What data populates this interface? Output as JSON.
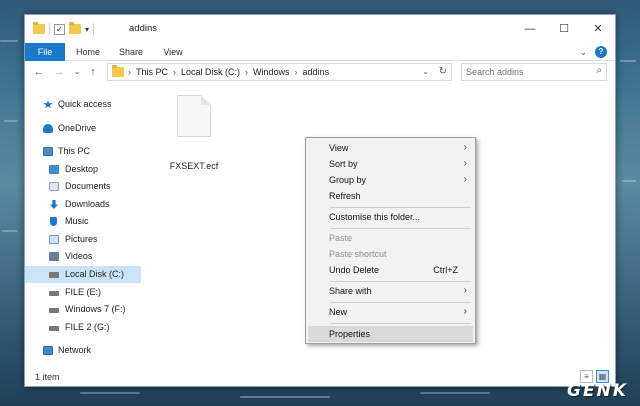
{
  "window": {
    "title": "addins",
    "controls": {
      "minimize": "—",
      "maximize": "☐",
      "close": "✕"
    }
  },
  "ribbon": {
    "tabs": [
      "File",
      "Home",
      "Share",
      "View"
    ],
    "expand_glyph": "⌄",
    "help_glyph": "?"
  },
  "nav": {
    "back": "←",
    "forward": "→",
    "recent": "⌄",
    "up": "↑",
    "breadcrumb": [
      "This PC",
      "Local Disk (C:)",
      "Windows",
      "addins"
    ],
    "crumb_sep": "›",
    "search_placeholder": "Search addins",
    "search_glyph": "⌕",
    "refresh_glyph": "↻",
    "dropdown_glyph": "⌄"
  },
  "navpane": {
    "items": [
      {
        "label": "Quick access",
        "icon": "star-icon",
        "color": "#1979ca"
      },
      {
        "label": "OneDrive",
        "icon": "cloud-icon",
        "color": "#1979ca"
      },
      {
        "label": "This PC",
        "icon": "computer-icon",
        "color": "#4a90c8"
      },
      {
        "label": "Desktop",
        "icon": "desktop-icon",
        "color": "#3a8ad0"
      },
      {
        "label": "Documents",
        "icon": "documents-icon",
        "color": "#8aa0b8"
      },
      {
        "label": "Downloads",
        "icon": "downloads-icon",
        "color": "#1979ca"
      },
      {
        "label": "Music",
        "icon": "music-icon",
        "color": "#1979ca"
      },
      {
        "label": "Pictures",
        "icon": "pictures-icon",
        "color": "#6fa0c8"
      },
      {
        "label": "Videos",
        "icon": "videos-icon",
        "color": "#6a7f99"
      },
      {
        "label": "Local Disk (C:)",
        "icon": "drive-icon",
        "color": "#777777"
      },
      {
        "label": "FILE (E:)",
        "icon": "drive-icon",
        "color": "#777777"
      },
      {
        "label": "Windows 7 (F:)",
        "icon": "drive-icon",
        "color": "#777777"
      },
      {
        "label": "FILE 2 (G:)",
        "icon": "drive-icon",
        "color": "#777777"
      },
      {
        "label": "Network",
        "icon": "network-icon",
        "color": "#3a8ad0"
      }
    ],
    "selected": "Local Disk (C:)"
  },
  "content": {
    "files": [
      {
        "name": "FXSEXT.ecf",
        "icon": "file-icon"
      }
    ]
  },
  "status": {
    "count": "1 item"
  },
  "context_menu": {
    "items": [
      {
        "label": "View",
        "submenu": true
      },
      {
        "label": "Sort by",
        "submenu": true
      },
      {
        "label": "Group by",
        "submenu": true
      },
      {
        "label": "Refresh"
      },
      {
        "label": "Customise this folder..."
      },
      {
        "label": "Paste",
        "disabled": true
      },
      {
        "label": "Paste shortcut",
        "disabled": true
      },
      {
        "label": "Undo Delete",
        "shortcut": "Ctrl+Z"
      },
      {
        "label": "Share with",
        "submenu": true
      },
      {
        "label": "New",
        "submenu": true
      },
      {
        "label": "Properties",
        "highlighted": true
      }
    ],
    "submenu_glyph": "›"
  },
  "watermark": "GENK",
  "colors": {
    "accent": "#1979ca",
    "selection": "#cce4f7",
    "folder": "#f2c94c"
  }
}
